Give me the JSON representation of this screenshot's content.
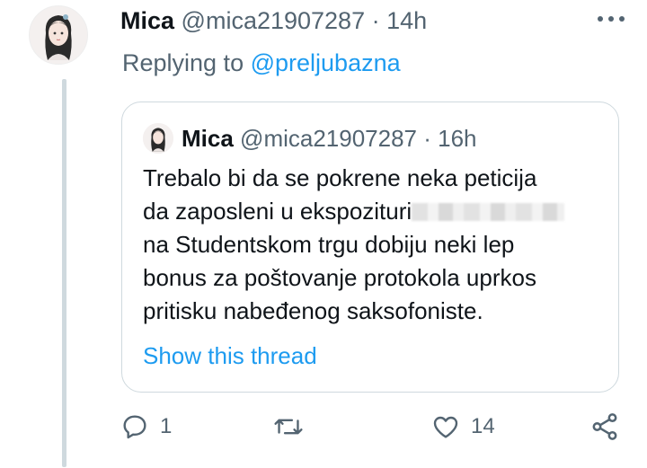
{
  "tweet": {
    "name": "Mica",
    "handle": "@mica21907287",
    "time": "· 14h",
    "replying_prefix": "Replying to",
    "replying_handle": "@preljubazna"
  },
  "quoted": {
    "name": "Mica",
    "handle": "@mica21907287",
    "time": "· 16h",
    "lines": [
      "Trebalo bi da se pokrene neka peticija",
      "da zaposleni u ekspozituri",
      "na Studentskom trgu dobiju neki lep",
      "bonus za poštovanje protokola uprkos",
      "pritisku nabeđenog saksofoniste."
    ],
    "show_thread": "Show this thread"
  },
  "actions": {
    "reply_count": "1",
    "retweet_count": "",
    "like_count": "14"
  },
  "icons": {
    "more": "more-horizontal-icon",
    "reply": "comment-icon",
    "retweet": "retweet-icon",
    "like": "heart-icon",
    "share": "share-icon"
  },
  "colors": {
    "accent": "#1d9bf0",
    "muted": "#536471",
    "text": "#0f1419",
    "border": "#cfd9de"
  }
}
